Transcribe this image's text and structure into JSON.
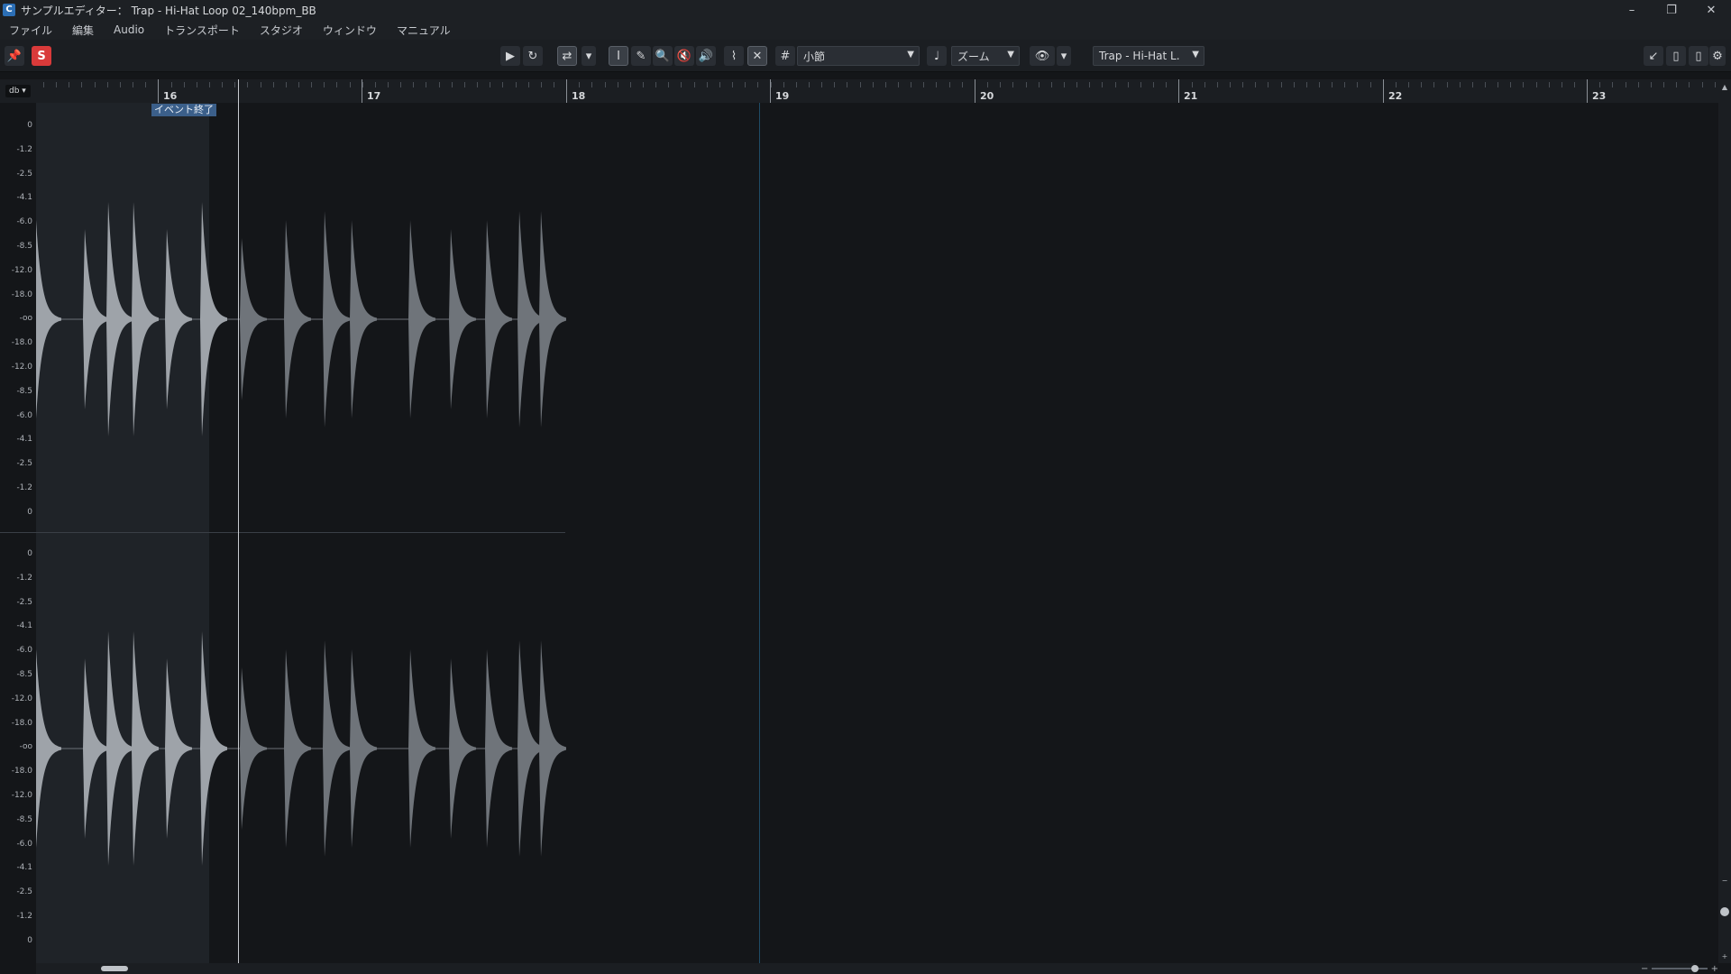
{
  "window": {
    "title": "サンプルエディター： Trap - Hi-Hat Loop 02_140bpm_BB",
    "controls": [
      "minimize-icon",
      "restore-icon",
      "close-icon"
    ]
  },
  "menu": [
    "ファイル",
    "編集",
    "Audio",
    "トランスポート",
    "スタジオ",
    "ウィンドウ",
    "マニュアル"
  ],
  "toolbar": {
    "grid_value": "小節",
    "zoom_label": "ズーム",
    "event_select": "Trap - Hi-Hat L."
  },
  "ruler": {
    "unit": "db",
    "bars": [
      "16",
      "17",
      "18",
      "19",
      "20",
      "21",
      "22",
      "23"
    ],
    "event_end_label": "イベント終了"
  },
  "scale": {
    "channel1": [
      "0",
      "-1.2",
      "-2.5",
      "-4.1",
      "-6.0",
      "-8.5",
      "-12.0",
      "-18.0",
      "-oo",
      "-18.0",
      "-12.0",
      "-8.5",
      "-6.0",
      "-4.1",
      "-2.5",
      "-1.2",
      "0"
    ],
    "channel2": [
      "0",
      "-1.2",
      "-2.5",
      "-4.1",
      "-6.0",
      "-8.5",
      "-12.0",
      "-18.0",
      "-oo",
      "-18.0",
      "-12.0",
      "-8.5",
      "-6.0",
      "-4.1",
      "-2.5",
      "-1.2",
      "0"
    ]
  },
  "colors": {
    "background": "#141619",
    "sample_region": "#1f2328",
    "waveform": "#9ea3a9",
    "event_tag": "#3b5f8a",
    "record_red": "#d93a3a"
  }
}
